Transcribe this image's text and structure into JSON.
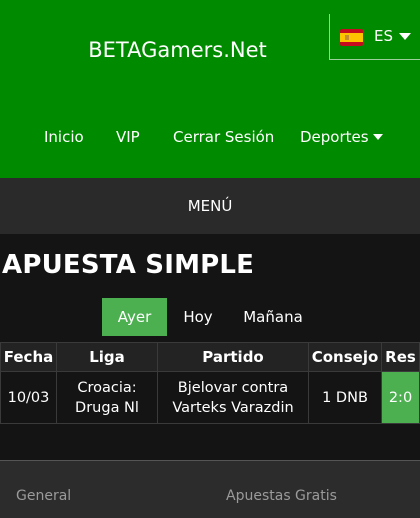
{
  "header": {
    "brand": "BETAGamers.Net",
    "language": {
      "code": "ES",
      "flag_icon": "spain-flag-icon"
    },
    "nav": {
      "home": "Inicio",
      "vip": "VIP",
      "logout": "Cerrar Sesión",
      "sports": "Deportes"
    }
  },
  "menu": {
    "label": "MENÚ"
  },
  "page": {
    "title": "APUESTA SIMPLE"
  },
  "tabs": [
    {
      "label": "Ayer",
      "active": true
    },
    {
      "label": "Hoy",
      "active": false
    },
    {
      "label": "Mañana",
      "active": false
    }
  ],
  "table": {
    "headers": [
      "Fecha",
      "Liga",
      "Partido",
      "Consejo",
      "Res"
    ],
    "rows": [
      {
        "date": "10/03",
        "league": "Croacia: Druga Nl",
        "match": "Bjelovar contra Varteks Varazdin",
        "tip": "1 DNB",
        "result": "2:0"
      }
    ]
  },
  "footer": {
    "general": "General",
    "free_bets": "Apuestas Gratis"
  },
  "colors": {
    "brand_green": "#008a00",
    "accent_green": "#4caf50",
    "dark_bg": "#141414"
  }
}
